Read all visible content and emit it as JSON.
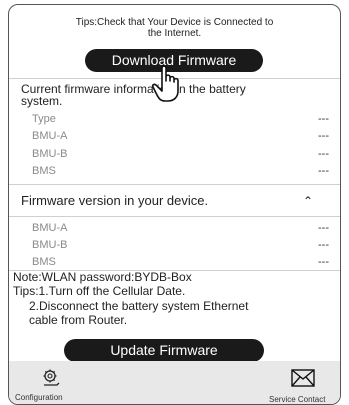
{
  "header": {
    "tips_line1": "Tips:Check that Your Device is Connected to",
    "tips_line2": "the Internet."
  },
  "download_button": "Download Firmware",
  "battery_info": {
    "title_line1": "Current firmware information in the battery",
    "title_line2": "system.",
    "rows": [
      {
        "label": "Type",
        "value": "---"
      },
      {
        "label": "BMU-A",
        "value": "---"
      },
      {
        "label": "BMU-B",
        "value": "---"
      },
      {
        "label": "BMS",
        "value": "---"
      }
    ]
  },
  "device_info": {
    "title": "Firmware version in your device.",
    "rows": [
      {
        "label": "BMU-A",
        "value": "---"
      },
      {
        "label": "BMU-B",
        "value": "---"
      },
      {
        "label": "BMS",
        "value": "---"
      }
    ]
  },
  "notes": {
    "wlan": "Note:WLAN password:BYDB-Box",
    "tip1": "Tips:1.Turn off the Cellular Date.",
    "tip2_line1": "2.Disconnect the battery system Ethernet",
    "tip2_line2": "cable from Router."
  },
  "update_button": "Update Firmware",
  "tabbar": {
    "configuration": {
      "label": "Configuration",
      "icon": "gear-hand-icon"
    },
    "service_contact": {
      "label": "Service Contact",
      "icon": "envelope-icon"
    }
  }
}
